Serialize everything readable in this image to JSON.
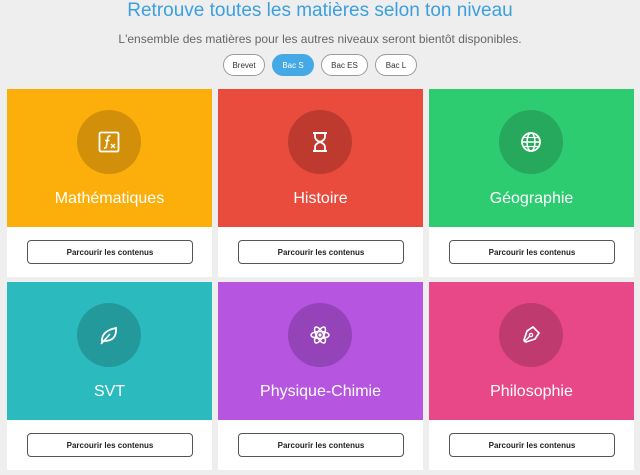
{
  "header": {
    "title": "Retrouve toutes les matières selon ton niveau",
    "subtitle": "L'ensemble des matières pour les autres niveaux seront bientôt disponibles."
  },
  "levels": [
    {
      "label": "Brevet",
      "active": false
    },
    {
      "label": "Bac S",
      "active": true
    },
    {
      "label": "Bac ES",
      "active": false
    },
    {
      "label": "Bac L",
      "active": false
    }
  ],
  "cards": [
    {
      "name": "Mathématiques",
      "icon": "function-icon",
      "color": "#fcaf0b",
      "circle": "#d18f0a",
      "button": "Parcourir les contenus"
    },
    {
      "name": "Histoire",
      "icon": "hourglass-icon",
      "color": "#e94c3d",
      "circle": "#bf3a2e",
      "button": "Parcourir les contenus"
    },
    {
      "name": "Géographie",
      "icon": "globe-icon",
      "color": "#2ecc71",
      "circle": "#26a85d",
      "button": "Parcourir les contenus"
    },
    {
      "name": "SVT",
      "icon": "leaf-icon",
      "color": "#2bbbbf",
      "circle": "#24999c",
      "button": "Parcourir les contenus"
    },
    {
      "name": "Physique-Chimie",
      "icon": "atom-icon",
      "color": "#b555e0",
      "circle": "#9443b8",
      "button": "Parcourir les contenus"
    },
    {
      "name": "Philosophie",
      "icon": "pen-nib-icon",
      "color": "#e84887",
      "circle": "#bf3a6f",
      "button": "Parcourir les contenus"
    }
  ]
}
